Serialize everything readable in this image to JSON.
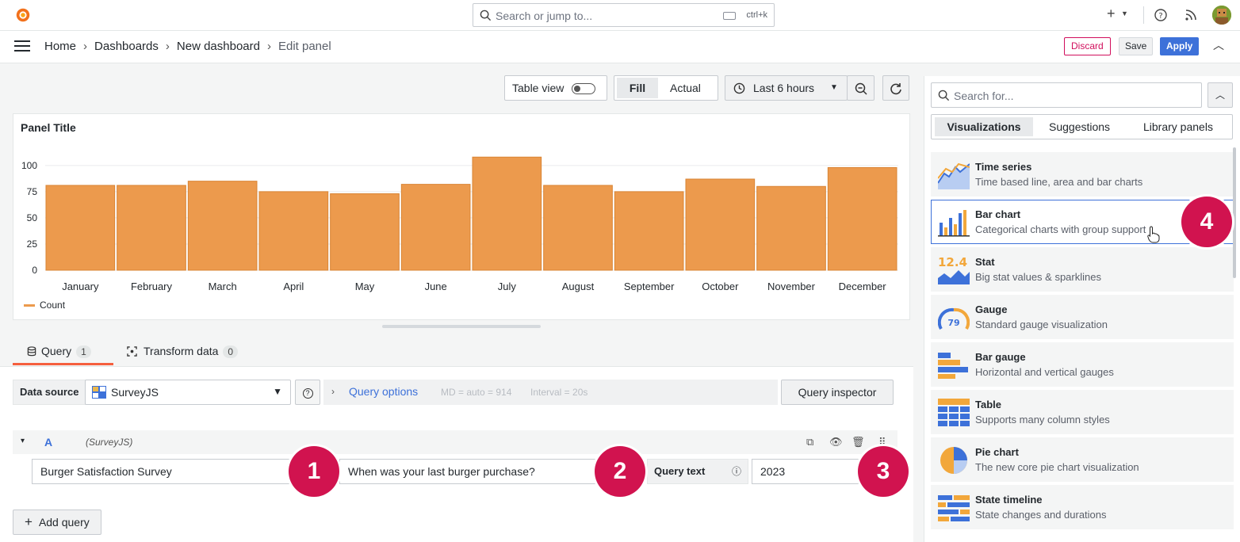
{
  "topbar": {
    "search_placeholder": "Search or jump to...",
    "shortcut": "ctrl+k"
  },
  "breadcrumbs": [
    "Home",
    "Dashboards",
    "New dashboard",
    "Edit panel"
  ],
  "breadcrumb_sep": "›",
  "actions": {
    "discard": "Discard",
    "save": "Save",
    "apply": "Apply"
  },
  "toolbar": {
    "table_view": "Table view",
    "fill": "Fill",
    "actual": "Actual",
    "time_range": "Last 6 hours"
  },
  "panel": {
    "title": "Panel Title",
    "legend": "Count"
  },
  "chart_data": {
    "type": "bar",
    "categories": [
      "January",
      "February",
      "March",
      "April",
      "May",
      "June",
      "July",
      "August",
      "September",
      "October",
      "November",
      "December"
    ],
    "series": [
      {
        "name": "Count",
        "values": [
          81,
          81,
          85,
          75,
          73,
          82,
          108,
          81,
          75,
          87,
          80,
          98
        ],
        "color": "#ec9a4d"
      }
    ],
    "yticks": [
      0,
      25,
      50,
      75,
      100
    ],
    "ylim": [
      0,
      115
    ],
    "grid": true,
    "legend": "bottom-left"
  },
  "tabs": [
    {
      "label": "Query",
      "count": "1"
    },
    {
      "label": "Transform data",
      "count": "0"
    }
  ],
  "datasource": {
    "label": "Data source",
    "value": "SurveyJS",
    "query_options": "Query options",
    "md": "MD = auto = 914",
    "interval": "Interval = 20s",
    "inspector": "Query inspector"
  },
  "query": {
    "letter": "A",
    "datasource": "(SurveyJS)",
    "survey": "Burger Satisfaction Survey",
    "question": "When was your last burger purchase?",
    "query_text_label": "Query text",
    "query_text": "2023",
    "add_query": "Add query"
  },
  "markers": [
    "1",
    "2",
    "3",
    "4"
  ],
  "visualizations": {
    "search_placeholder": "Search for...",
    "tabs": [
      "Visualizations",
      "Suggestions",
      "Library panels"
    ],
    "items": [
      {
        "name": "Time series",
        "desc": "Time based line, area and bar charts"
      },
      {
        "name": "Bar chart",
        "desc": "Categorical charts with group support"
      },
      {
        "name": "Stat",
        "desc": "Big stat values & sparklines",
        "thumb_text": "12.4"
      },
      {
        "name": "Gauge",
        "desc": "Standard gauge visualization",
        "thumb_text": "79"
      },
      {
        "name": "Bar gauge",
        "desc": "Horizontal and vertical gauges"
      },
      {
        "name": "Table",
        "desc": "Supports many column styles"
      },
      {
        "name": "Pie chart",
        "desc": "The new core pie chart visualization"
      },
      {
        "name": "State timeline",
        "desc": "State changes and durations"
      }
    ]
  },
  "colors": {
    "accent": "#3d71d9",
    "bar": "#ec9a4d",
    "marker": "#d1134f",
    "discard": "#d10e5c"
  }
}
